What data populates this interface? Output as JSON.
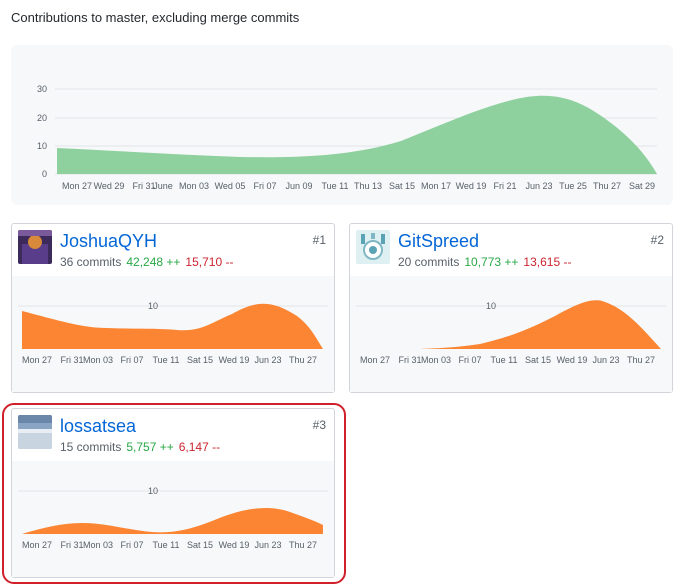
{
  "heading": "Contributions to master, excluding merge commits",
  "main_chart": {
    "y_ticks": [
      "0",
      "10",
      "20",
      "30"
    ],
    "x_ticks": [
      "Mon 27",
      "Wed 29",
      "Fri 31",
      "June",
      "Mon 03",
      "Wed 05",
      "Fri 07",
      "Jun 09",
      "Tue 11",
      "Thu 13",
      "Sat 15",
      "Mon 17",
      "Wed 19",
      "Fri 21",
      "Jun 23",
      "Tue 25",
      "Thu 27",
      "Sat 29"
    ]
  },
  "contributors": [
    {
      "name": "JoshuaQYH",
      "rank": "#1",
      "commits": "36 commits",
      "additions": "42,248 ++",
      "deletions": "15,710 --",
      "y_tick": "10",
      "x_ticks": [
        "Mon 27",
        "Fri 31",
        "Mon 03",
        "Fri 07",
        "Tue 11",
        "Sat 15",
        "Wed 19",
        "Jun 23",
        "Thu 27"
      ]
    },
    {
      "name": "GitSpreed",
      "rank": "#2",
      "commits": "20 commits",
      "additions": "10,773 ++",
      "deletions": "13,615 --",
      "y_tick": "10",
      "x_ticks": [
        "Mon 27",
        "Fri 31",
        "Mon 03",
        "Fri 07",
        "Tue 11",
        "Sat 15",
        "Wed 19",
        "Jun 23",
        "Thu 27"
      ]
    },
    {
      "name": "lossatsea",
      "rank": "#3",
      "commits": "15 commits",
      "additions": "5,757 ++",
      "deletions": "6,147 --",
      "y_tick": "10",
      "x_ticks": [
        "Mon 27",
        "Fri 31",
        "Mon 03",
        "Fri 07",
        "Tue 11",
        "Sat 15",
        "Wed 19",
        "Jun 23",
        "Thu 27"
      ]
    }
  ],
  "colors": {
    "main_area": "#8fd19e",
    "contrib_area": "#fb8532",
    "link": "#0366d6",
    "add": "#28a745",
    "del": "#cb2431",
    "highlight": "#d0202a"
  }
}
